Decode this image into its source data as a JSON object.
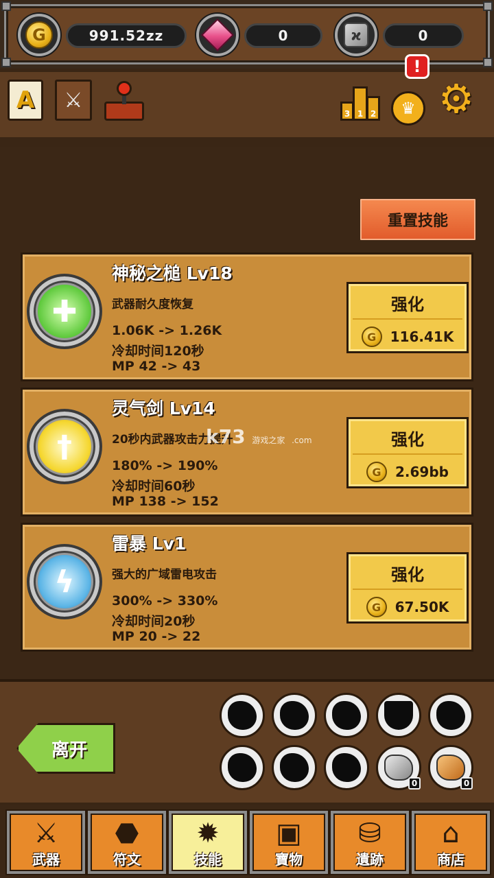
{
  "resources": {
    "gold": {
      "icon": "gold-coin-icon",
      "value": "991.52zz"
    },
    "gems": {
      "icon": "pink-gem-icon",
      "value": "0"
    },
    "runes": {
      "icon": "rune-stone-icon",
      "value": "0"
    }
  },
  "hud": {
    "lang_glyph": "A",
    "alert_glyph": "!"
  },
  "reset_button": "重置技能",
  "skills": [
    {
      "title": "神秘之槌 Lv18",
      "desc": "武器耐久度恢复",
      "stat1": "1.06K -> 1.26K",
      "stat2": "冷却时间120秒",
      "stat3": "MP 42 -> 43",
      "upgrade_label": "强化",
      "cost": "116.41K",
      "orb_icon": "hammer-icon"
    },
    {
      "title": "灵气剑 Lv14",
      "desc": "20秒内武器攻击力提升",
      "stat1": "180% -> 190%",
      "stat2": "冷却时间60秒",
      "stat3": "MP 138 -> 152",
      "upgrade_label": "强化",
      "cost": "2.69bb",
      "orb_icon": "sword-icon"
    },
    {
      "title": "雷暴 Lv1",
      "desc": "强大的广域雷电攻击",
      "stat1": "300% -> 330%",
      "stat2": "冷却时间20秒",
      "stat3": "MP 20 -> 22",
      "upgrade_label": "强化",
      "cost": "67.50K",
      "orb_icon": "lightning-icon"
    }
  ],
  "watermark": {
    "main": "k73",
    "sub": "游戏之家",
    "domain": ".com"
  },
  "leave_button": "离开",
  "slots": [
    {
      "count": ""
    },
    {
      "count": ""
    },
    {
      "count": ""
    },
    {
      "count": ""
    },
    {
      "count": ""
    },
    {
      "count": ""
    },
    {
      "count": ""
    },
    {
      "count": ""
    },
    {
      "count": "0"
    },
    {
      "count": "0"
    }
  ],
  "nav": [
    {
      "label": "武器",
      "icon": "crossed-swords-icon",
      "active": false
    },
    {
      "label": "符文",
      "icon": "rune-icon",
      "active": false
    },
    {
      "label": "技能",
      "icon": "skill-book-icon",
      "active": true
    },
    {
      "label": "寶物",
      "icon": "treasure-chest-icon",
      "active": false
    },
    {
      "label": "遺跡",
      "icon": "ruins-pot-icon",
      "active": false
    },
    {
      "label": "商店",
      "icon": "shop-icon",
      "active": false
    }
  ]
}
